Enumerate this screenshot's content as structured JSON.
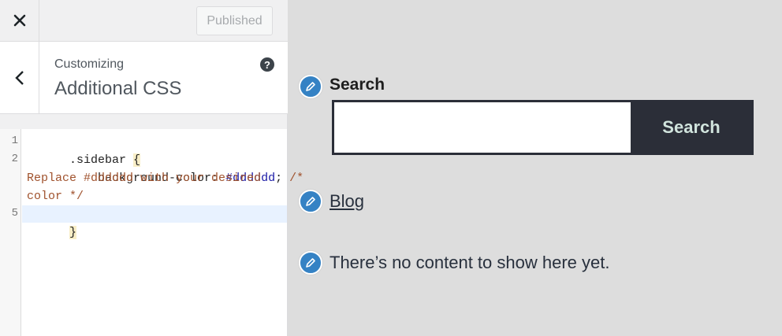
{
  "header": {
    "publish_label": "Published"
  },
  "section": {
    "customizing_label": "Customizing",
    "title": "Additional CSS",
    "help_glyph": "?"
  },
  "editor": {
    "line_numbers": [
      "1",
      "2",
      "5"
    ],
    "code": {
      "l1_selector": ".sidebar ",
      "l1_brace": "{",
      "l2_prop": "    background-color: ",
      "l2_val": "#dddddd",
      "l2_semi": "; ",
      "l2_comment_start": "/*",
      "l3_comment": "Replace #dddddd with your desired",
      "l4_comment": "color */",
      "l5_brace": "}"
    }
  },
  "preview": {
    "search_heading": "Search",
    "search_input_value": "",
    "search_button_label": "Search",
    "blog_link": "Blog",
    "empty_message": "There’s no content to show here yet."
  },
  "colors": {
    "accent": "#3582c4",
    "preview_background": "#dddddd",
    "search_dark": "#2b2e38"
  }
}
